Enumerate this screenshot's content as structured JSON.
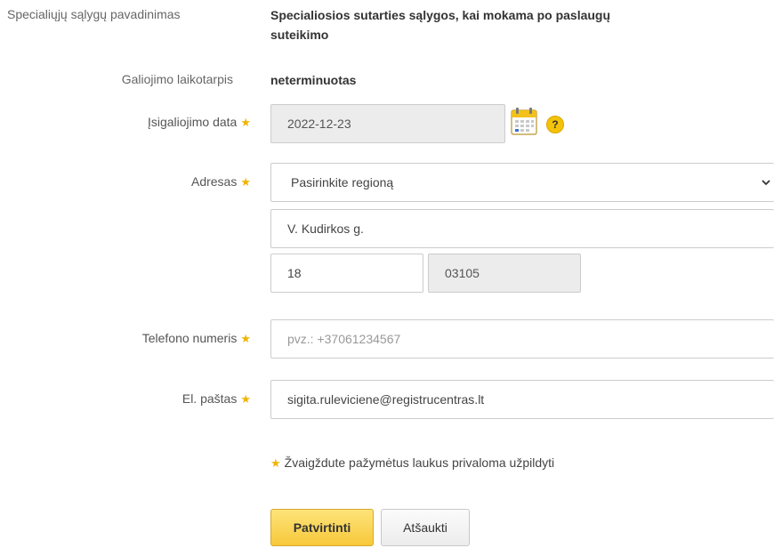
{
  "form": {
    "special_conditions": {
      "label": "Specialiųjų sąlygų pavadinimas",
      "value_line1": "Specialiosios sutarties sąlygos, kai mokama po paslaugų",
      "value_line2": "suteikimo"
    },
    "validity": {
      "label": "Galiojimo laikotarpis",
      "value": "neterminuotas"
    },
    "effective_date": {
      "label": "Įsigaliojimo data",
      "value": "2022-12-23",
      "help_symbol": "?"
    },
    "address": {
      "label": "Adresas",
      "region_value": "Pasirinkite regioną",
      "street_value": "V. Kudirkos g.",
      "house_value": "18",
      "postcode_value": "03105"
    },
    "phone": {
      "label": "Telefono numeris",
      "placeholder": "pvz.: +37061234567"
    },
    "email": {
      "label": "El. paštas",
      "value": "sigita.ruleviciene@registrucentras.lt"
    },
    "required_star": "★",
    "required_note": "Žvaigždute pažymėtus laukus privaloma užpildyti"
  },
  "actions": {
    "confirm_label": "Patvirtinti",
    "cancel_label": "Atšaukti"
  },
  "icons": {
    "calendar": "calendar-icon",
    "help": "help-icon",
    "dropdown": "chevron-down-icon",
    "required": "required-star-icon"
  },
  "colors": {
    "required_star": "#f0b400",
    "primary_button": "#fcd34d",
    "disabled_field": "#ececec",
    "help_badge": "#f3c20a"
  }
}
